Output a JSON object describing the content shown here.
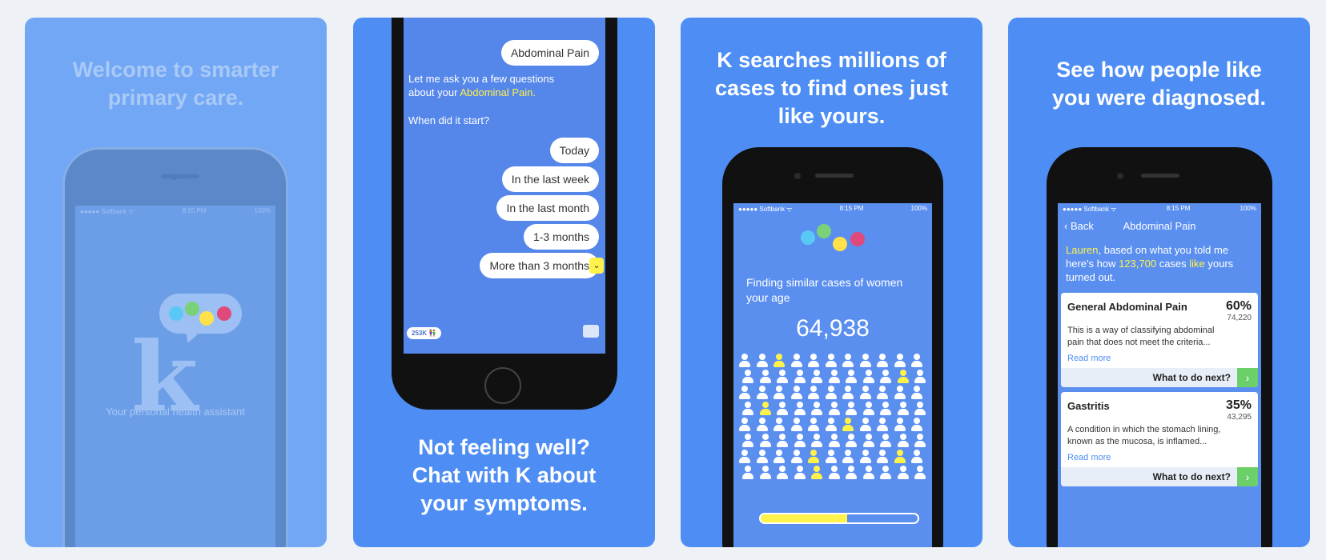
{
  "panel1": {
    "headline": [
      "Welcome to smarter",
      "primary care."
    ],
    "status": {
      "carrier": "●●●●● Softbank ᯤ",
      "time": "8:15 PM",
      "battery": "100%"
    },
    "logo": "k",
    "tagline": "Your personal health assistant",
    "colors": [
      "#5ac8f5",
      "#7ad17a",
      "#ffe14a",
      "#e04a7a"
    ]
  },
  "panel2": {
    "headline": [
      "Not feeling well?",
      "Chat with K about",
      "your symptoms."
    ],
    "selected_chip": "Abdominal Pain",
    "question_prefix": "Let me ask you a few questions about your ",
    "question_highlight": "Abdominal Pain.",
    "when": "When did it start?",
    "options": [
      "Today",
      "In the last week",
      "In the last month",
      "1-3 months",
      "More than 3 months"
    ],
    "badge": "253K 👫"
  },
  "panel3": {
    "headline": [
      "K searches millions of",
      "cases to find ones just",
      "like yours."
    ],
    "status": {
      "carrier": "●●●●● Softbank ᯤ",
      "time": "8:15 PM",
      "battery": "100%"
    },
    "finding": "Finding similar cases of women your age",
    "count": "64,938",
    "progress": 0.55,
    "colors": [
      "#5ac8f5",
      "#7ad17a",
      "#ffe14a",
      "#e04a7a"
    ]
  },
  "panel4": {
    "headline": [
      "See how people like",
      "you were diagnosed."
    ],
    "status": {
      "carrier": "●●●●● Softbank ᯤ",
      "time": "8:15 PM",
      "battery": "100%"
    },
    "back": "‹ Back",
    "title": "Abdominal Pain",
    "intro": {
      "name": "Lauren",
      "mid1": ", based on what you told me here's how ",
      "cases": "123,700",
      "mid2": " cases ",
      "like": "like",
      "end": " yours turned out."
    },
    "cards": [
      {
        "name": "General Abdominal Pain",
        "pct": "60%",
        "n": "74,220",
        "desc": "This is a way of classifying abdominal pain that does not meet the criteria...",
        "more": "Read more",
        "next": "What to do next?"
      },
      {
        "name": "Gastritis",
        "pct": "35%",
        "n": "43,295",
        "desc": "A condition in which the stomach lining, known as the mucosa, is inflamed...",
        "more": "Read more",
        "next": "What to do next?"
      }
    ]
  }
}
